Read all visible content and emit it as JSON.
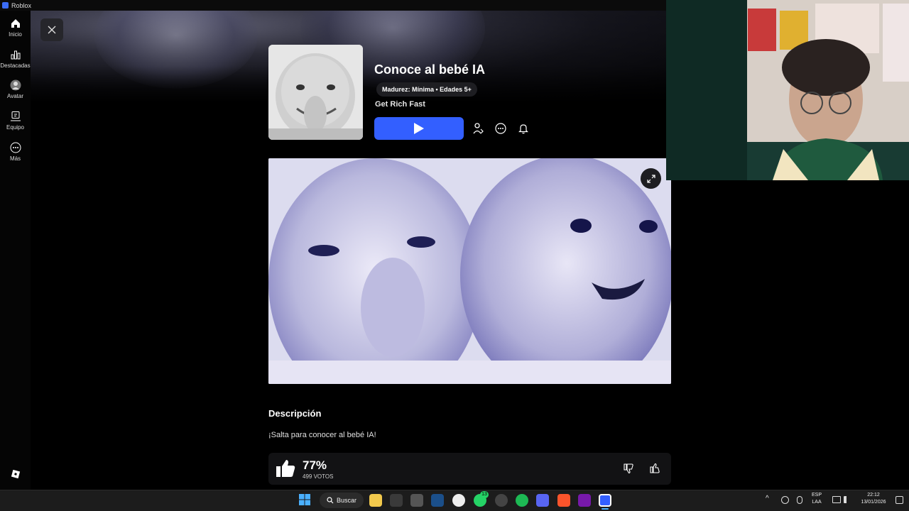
{
  "window": {
    "title": "Roblox"
  },
  "sidebar": {
    "items": [
      {
        "label": "Inicio",
        "icon": "home-icon"
      },
      {
        "label": "Destacadas",
        "icon": "chart-icon"
      },
      {
        "label": "Avatar",
        "icon": "avatar-icon"
      },
      {
        "label": "Equipo",
        "icon": "team-icon"
      },
      {
        "label": "Más",
        "icon": "more-icon"
      }
    ],
    "logo_icon": "roblox-logo-icon"
  },
  "game": {
    "title": "Conoce al bebé IA",
    "maturity": "Madurez: Mínima • Edades 5+",
    "creator": "Get Rich Fast",
    "description_heading": "Descripción",
    "description": "¡Salta para conocer al bebé IA!",
    "rating_percent": "77%",
    "votes": "499 VOTOS"
  },
  "taskbar": {
    "search_label": "Buscar",
    "lang_top": "ESP",
    "lang_bottom": "LAA",
    "time": "22:12",
    "date": "13/01/2026",
    "whatsapp_badge": "13"
  },
  "colors": {
    "accent": "#335fff",
    "background": "#000000",
    "panel": "#121214"
  }
}
